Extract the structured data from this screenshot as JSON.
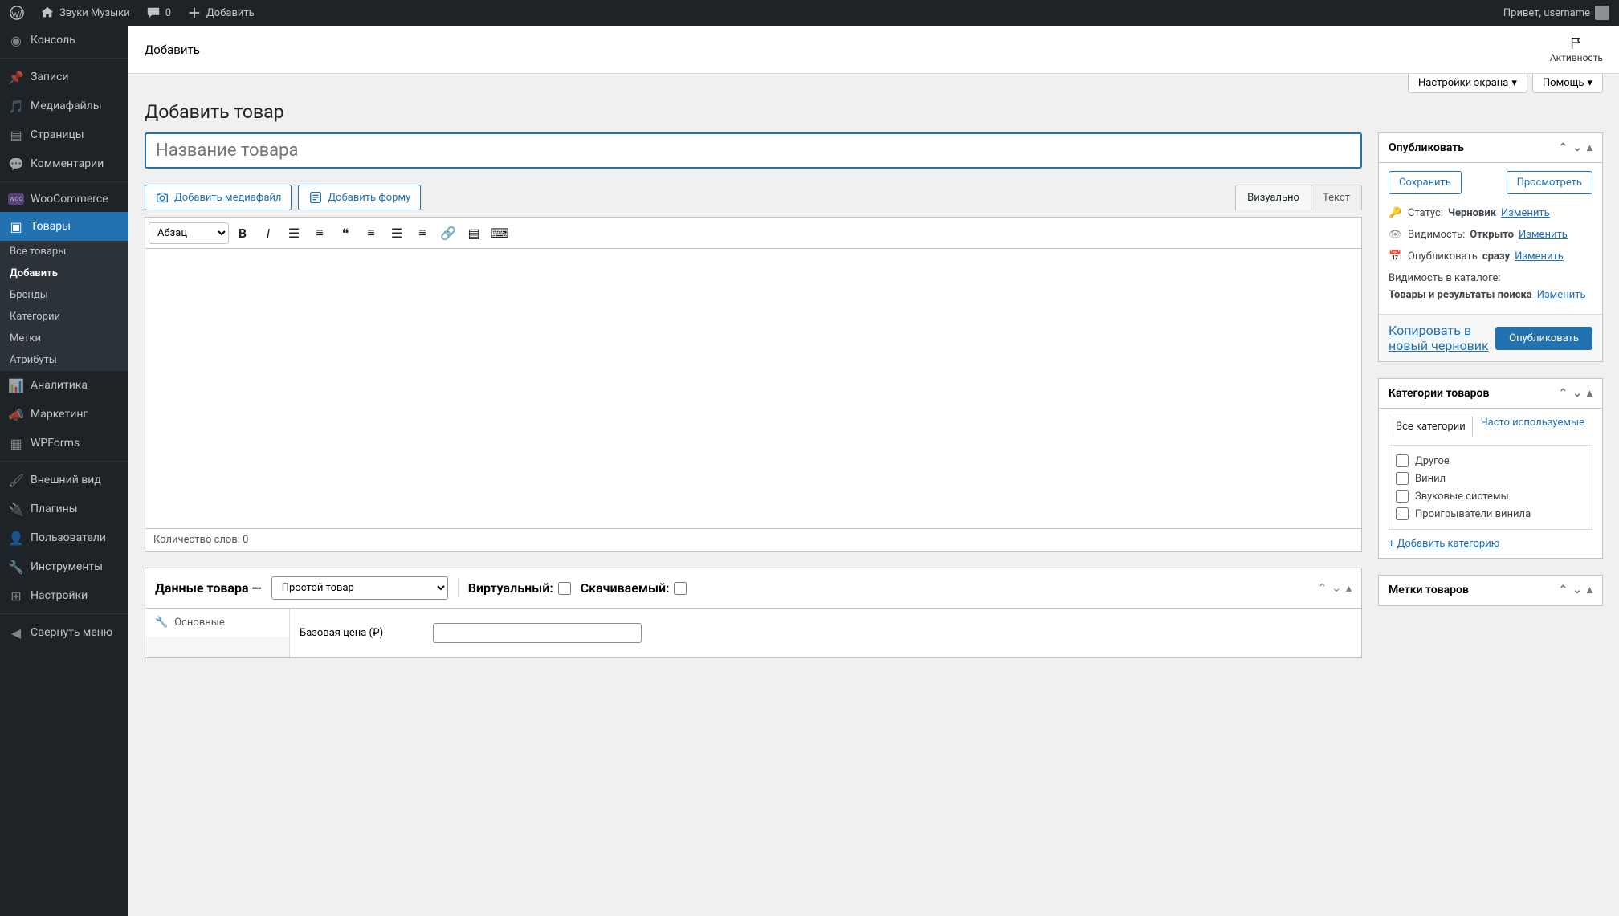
{
  "adminbar": {
    "site_name": "Звуки Музыки",
    "comments_count": "0",
    "add_new": "Добавить",
    "greeting": "Привет, username"
  },
  "sidebar": {
    "items": [
      {
        "label": "Консоль"
      },
      {
        "label": "Записи"
      },
      {
        "label": "Медиафайлы"
      },
      {
        "label": "Страницы"
      },
      {
        "label": "Комментарии"
      },
      {
        "label": "WooCommerce"
      },
      {
        "label": "Товары"
      },
      {
        "label": "Аналитика"
      },
      {
        "label": "Маркетинг"
      },
      {
        "label": "WPForms"
      },
      {
        "label": "Внешний вид"
      },
      {
        "label": "Плагины"
      },
      {
        "label": "Пользователи"
      },
      {
        "label": "Инструменты"
      },
      {
        "label": "Настройки"
      },
      {
        "label": "Свернуть меню"
      }
    ],
    "products_submenu": [
      {
        "label": "Все товары"
      },
      {
        "label": "Добавить"
      },
      {
        "label": "Бренды"
      },
      {
        "label": "Категории"
      },
      {
        "label": "Метки"
      },
      {
        "label": "Атрибуты"
      }
    ]
  },
  "header": {
    "strip_title": "Добавить",
    "activity_label": "Активность",
    "screen_options": "Настройки экрана",
    "help": "Помощь"
  },
  "page": {
    "title": "Добавить товар",
    "title_placeholder": "Название товара"
  },
  "editor": {
    "add_media": "Добавить медиафайл",
    "add_form": "Добавить форму",
    "tab_visual": "Визуально",
    "tab_text": "Текст",
    "format_dropdown": "Абзац",
    "word_count": "Количество слов: 0"
  },
  "publish": {
    "title": "Опубликовать",
    "save_draft": "Сохранить",
    "preview": "Просмотреть",
    "status_label": "Статус:",
    "status_value": "Черновик",
    "visibility_label": "Видимость:",
    "visibility_value": "Открыто",
    "publish_label": "Опубликовать",
    "publish_value": "сразу",
    "catalog_label": "Видимость в каталоге:",
    "catalog_value": "Товары и результаты поиска",
    "edit": "Изменить",
    "copy_draft": "Копировать в новый черновик",
    "publish_button": "Опубликовать"
  },
  "categories": {
    "title": "Категории товаров",
    "tab_all": "Все категории",
    "tab_recent": "Часто используемые",
    "items": [
      {
        "label": "Другое"
      },
      {
        "label": "Винил"
      },
      {
        "label": "Звуковые системы"
      },
      {
        "label": "Проигрыватели винила"
      }
    ],
    "add_new": "+ Добавить категорию"
  },
  "tags": {
    "title": "Метки товаров"
  },
  "product_data": {
    "title": "Данные товара —",
    "type": "Простой товар",
    "virtual_label": "Виртуальный:",
    "downloadable_label": "Скачиваемый:",
    "tab_general": "Основные",
    "base_price_label": "Базовая цена (₽)"
  }
}
